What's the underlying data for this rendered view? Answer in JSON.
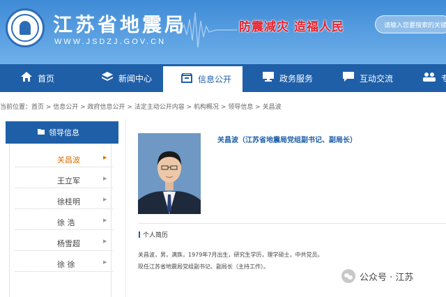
{
  "header": {
    "site_title": "江苏省地震局",
    "site_url": "WWW.JSDZJ.GOV.CN",
    "slogan": "防震减灾  造福人民",
    "search_placeholder": "请输入您要搜索的关键字"
  },
  "nav": {
    "items": [
      {
        "label": "首页",
        "icon": "home-icon"
      },
      {
        "label": "新闻中心",
        "icon": "layers-icon"
      },
      {
        "label": "信息公开",
        "icon": "inbox-icon"
      },
      {
        "label": "政务服务",
        "icon": "monitor-icon"
      },
      {
        "label": "互动交流",
        "icon": "chat-icon"
      },
      {
        "label": "专",
        "icon": "people-icon"
      }
    ],
    "active_index": 2
  },
  "breadcrumb": "当前位置：首页 > 信息公开 > 政府信息公开 > 法定主动公开内容 > 机构概况 > 领导信息 > 关昌波",
  "sidebar": {
    "heading": "领导信息",
    "items": [
      {
        "label": "关昌波",
        "active": true
      },
      {
        "label": "王立军",
        "active": false
      },
      {
        "label": "徐桂明",
        "active": false
      },
      {
        "label": "徐  浩",
        "active": false
      },
      {
        "label": "杨雪超",
        "active": false
      },
      {
        "label": "徐  徐",
        "active": false
      }
    ]
  },
  "main": {
    "name_title": "关昌波（江苏省地震局党组副书记、副局长）",
    "section_label": "个人简历",
    "bio_line1": "关昌波，男，满族，1979年7月出生，研究生学历，理学硕士，中共党员。",
    "bio_line2": "现任江苏省地震局党组副书记、副局长（主持工作）。"
  },
  "watermark": "公众号 · 江苏"
}
